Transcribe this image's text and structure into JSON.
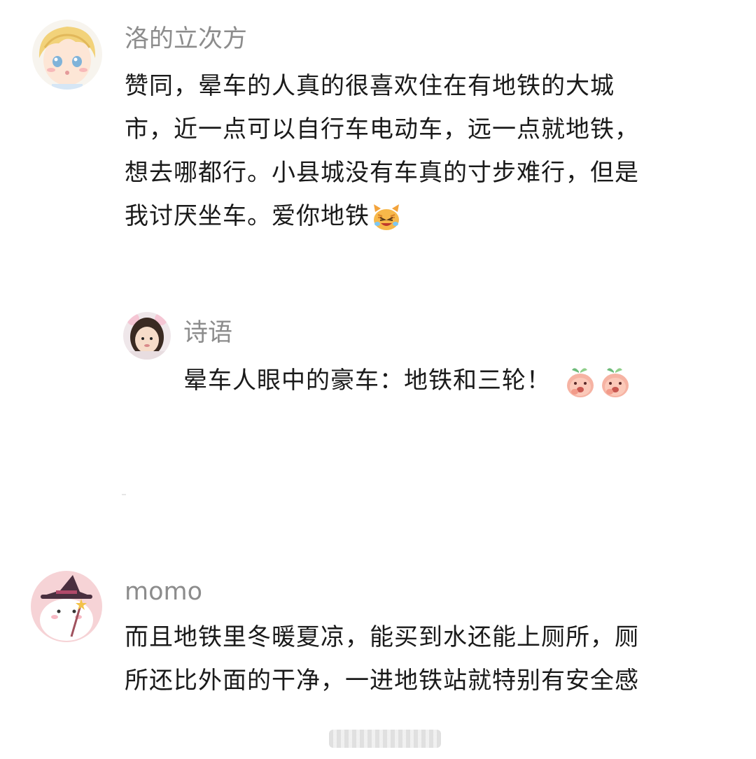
{
  "comments": [
    {
      "username": "洛的立次方",
      "avatar_icon": "blond-boy-avatar-icon",
      "lines": [
        "赞同，晕车的人真的很喜欢住在有地铁的大城",
        "市，近一点可以自行车电动车，远一点就地铁，",
        "想去哪都行。小县城没有车真的寸步难行，但是",
        "我讨厌坐车。爱你地铁"
      ],
      "emoji": "cat-crying-laughing-emoji",
      "reply": {
        "username": "诗语",
        "avatar_icon": "girl-photo-avatar-icon",
        "text": "晕车人眼中的豪车：地铁和三轮！",
        "emojis": [
          "peach-face-emoji",
          "peach-face-emoji"
        ]
      }
    },
    {
      "username": "momo",
      "avatar_icon": "snowman-witch-hat-avatar-icon",
      "lines": [
        "而且地铁里冬暖夏凉，能买到水还能上厕所，厕",
        "所还比外面的干净，一进地铁站就特别有安全感"
      ]
    }
  ],
  "colors": {
    "username": "#8c8c8c",
    "text": "#1a1a1a",
    "background": "#ffffff"
  }
}
